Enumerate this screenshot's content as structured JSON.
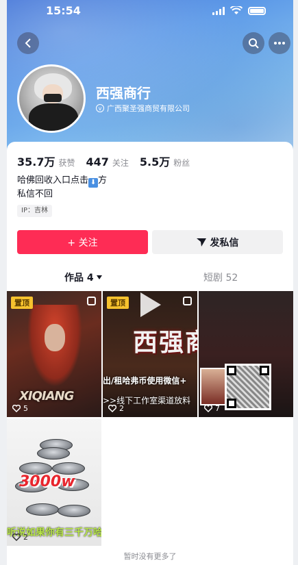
{
  "status_bar": {
    "time": "15:54"
  },
  "profile": {
    "name": "西强商行",
    "verification": "广西聚圣强商贸有限公司",
    "stats": [
      {
        "value": "35.7万",
        "label": "获赞"
      },
      {
        "value": "447",
        "label": "关注"
      },
      {
        "value": "5.5万",
        "label": "粉丝"
      }
    ],
    "bio_line1": "哈佛回收入口点击",
    "bio_line1_suffix": "方",
    "bio_line2": "私信不回",
    "ip": "IP：吉林"
  },
  "actions": {
    "follow": "+ 关注",
    "message": "发私信"
  },
  "tabs": [
    {
      "label": "作品 4",
      "active": true
    },
    {
      "label": "短剧 52",
      "active": false
    }
  ],
  "videos": [
    {
      "pinned_label": "置顶",
      "likes": "5",
      "overlay_text": "XIQIANG"
    },
    {
      "pinned_label": "置顶",
      "likes": "2",
      "overlay_text": "西强商行",
      "line1": "出/租哈弗币使用微信+",
      "line2": ">>线下工作室渠道放料"
    },
    {
      "likes": "7"
    },
    {
      "likes": "2",
      "amount": "3000w",
      "ticker": "听说如果你有三千万哈佛"
    }
  ],
  "footer": "暂时没有更多了",
  "colors": {
    "accent": "#fe2c55",
    "pin": "#f6c22e"
  }
}
